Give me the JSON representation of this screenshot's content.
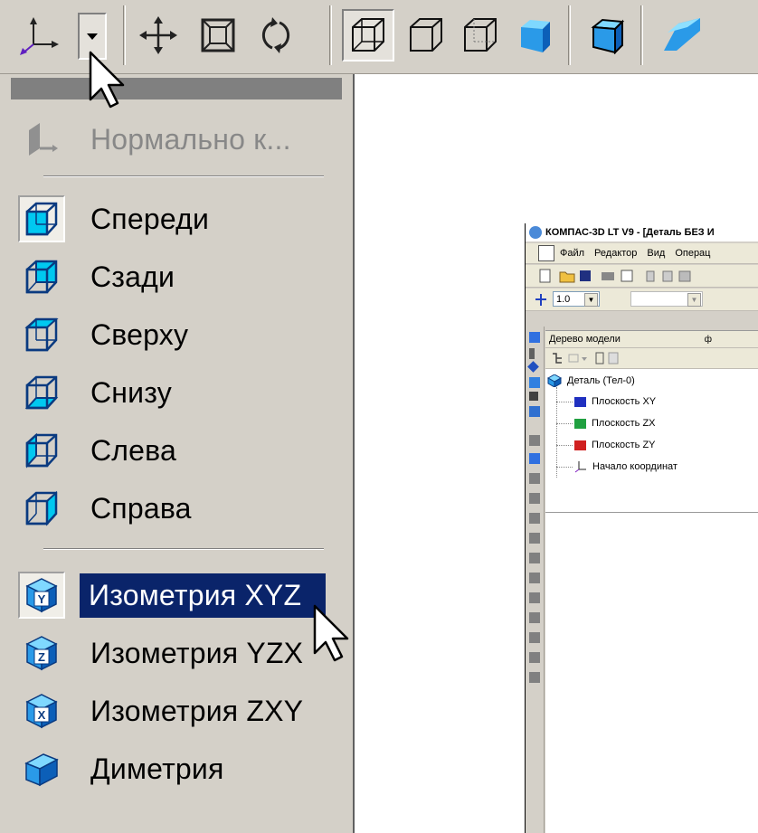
{
  "menu": {
    "items": [
      {
        "label": "Нормально к...",
        "icon": "normal-to-icon",
        "state": "disabled"
      },
      {
        "label": "Спереди",
        "icon": "wireframe-cube-icon",
        "state": "checked"
      },
      {
        "label": "Сзади",
        "icon": "wireframe-cube-icon",
        "state": "normal"
      },
      {
        "label": "Сверху",
        "icon": "wireframe-cube-icon",
        "state": "normal"
      },
      {
        "label": "Снизу",
        "icon": "wireframe-cube-icon",
        "state": "normal"
      },
      {
        "label": "Слева",
        "icon": "wireframe-cube-icon",
        "state": "normal"
      },
      {
        "label": "Справа",
        "icon": "wireframe-cube-icon",
        "state": "normal"
      },
      {
        "label": "Изометрия XYZ",
        "icon": "isometric-y-cube-icon",
        "state": "selected"
      },
      {
        "label": "Изометрия YZX",
        "icon": "isometric-z-cube-icon",
        "state": "normal"
      },
      {
        "label": "Изометрия ZXY",
        "icon": "isometric-x-cube-icon",
        "state": "normal"
      },
      {
        "label": "Диметрия",
        "icon": "dimetric-cube-icon",
        "state": "normal"
      }
    ],
    "badges": {
      "xyz": "Y",
      "yzx": "Z",
      "zxy": "X"
    }
  },
  "window": {
    "title": "КОМПАС-3D LT V9 - [Деталь БЕЗ И",
    "menubar": [
      "Файл",
      "Редактор",
      "Вид",
      "Операц"
    ],
    "scale_value": "1.0",
    "tree": {
      "header": "Дерево модели",
      "pin": "ф",
      "root": "Деталь (Тел-0)",
      "children": [
        {
          "label": "Плоскость XY",
          "color": "#2030c0"
        },
        {
          "label": "Плоскость ZX",
          "color": "#20a040"
        },
        {
          "label": "Плоскость ZY",
          "color": "#d02020"
        },
        {
          "label": "Начало координат",
          "color": "#8020c0"
        }
      ]
    }
  },
  "colors": {
    "accent_cyan": "#00c8f0",
    "menu_highlight": "#0a246a",
    "face_blue": "#2090e0"
  }
}
